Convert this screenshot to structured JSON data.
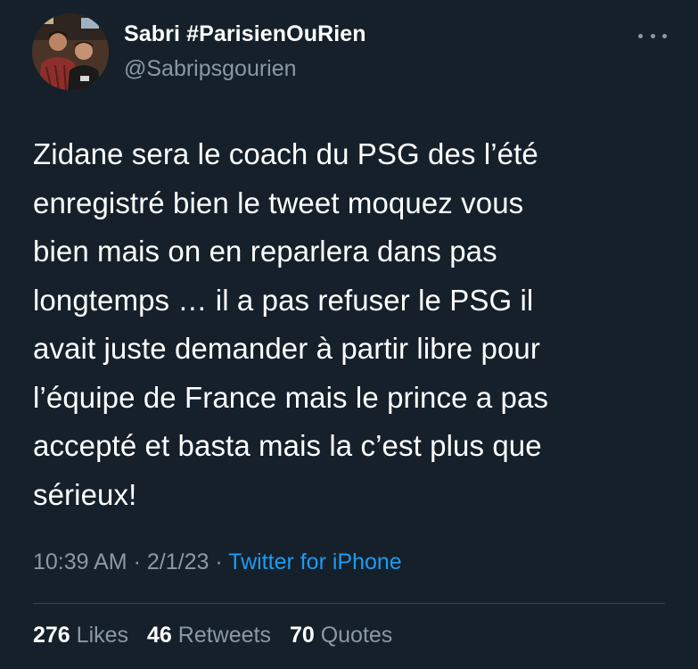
{
  "author": {
    "display_name": "Sabri #ParisienOuRien",
    "handle": "@Sabripsgourien",
    "avatar_icon": "profile-photo-icon"
  },
  "more_icon": "more-options-icon",
  "tweet": {
    "text": "Zidane sera le coach du PSG des l’été\nenregistré bien le tweet moquez vous\nbien mais on en reparlera dans pas\nlongtemps … il a pas refuser le PSG il\navait juste demander à partir libre pour\nl’équipe de France mais le prince a pas\naccepté et basta mais la c’est plus que\nsérieux!",
    "time": "10:39 AM",
    "separator": "·",
    "date": "2/1/23",
    "source": "Twitter for iPhone"
  },
  "stats": {
    "likes_count": "276",
    "likes_label": "Likes",
    "retweets_count": "46",
    "retweets_label": "Retweets",
    "quotes_count": "70",
    "quotes_label": "Quotes"
  },
  "colors": {
    "background": "#15202b",
    "secondary_text": "#8b98a5",
    "link": "#1d9bf0",
    "divider": "#38444d"
  }
}
